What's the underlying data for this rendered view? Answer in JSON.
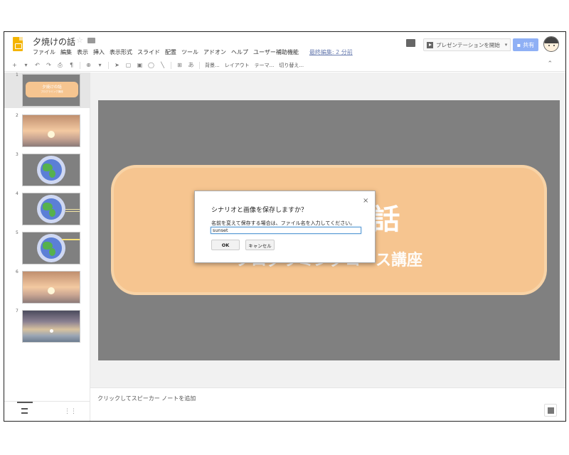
{
  "header": {
    "doc_title": "夕焼けの話",
    "menu": [
      "ファイル",
      "編集",
      "表示",
      "挿入",
      "表示形式",
      "スライド",
      "配置",
      "ツール",
      "アドオン",
      "ヘルプ",
      "ユーザー補助機能"
    ],
    "last_edit": "最終編集: 2 分前",
    "present_label": "プレゼンテーションを開始",
    "present_arrow": "▾",
    "share_label": "共有"
  },
  "toolbar": {
    "background_label": "背景...",
    "layout_label": "レイアウト",
    "theme_label": "テーマ...",
    "transition_label": "切り替え...",
    "collapse": "⌃"
  },
  "filmstrip": {
    "slides": [
      {
        "num": "1",
        "title": "夕焼けの話",
        "subtitle": "プログラミング講座"
      },
      {
        "num": "2"
      },
      {
        "num": "3"
      },
      {
        "num": "4"
      },
      {
        "num": "5"
      },
      {
        "num": "6"
      },
      {
        "num": "7"
      }
    ]
  },
  "slide": {
    "title": "夕焼けの話",
    "subtitle": "プログラミングコース講座"
  },
  "notes": {
    "placeholder": "クリックしてスピーカー ノートを追加"
  },
  "dialog": {
    "close": "×",
    "title": "シナリオと画像を保存しますか？",
    "message": "名前を変えて保存する場合は、ファイル名を入力してください。",
    "input_value": "sunset",
    "ok_label": "OK",
    "cancel_label": "キャンセル"
  },
  "colors": {
    "accent": "#8fb0f5",
    "slide_bg": "#808080",
    "pill": "#f6c590",
    "logo": "#f4b400"
  }
}
